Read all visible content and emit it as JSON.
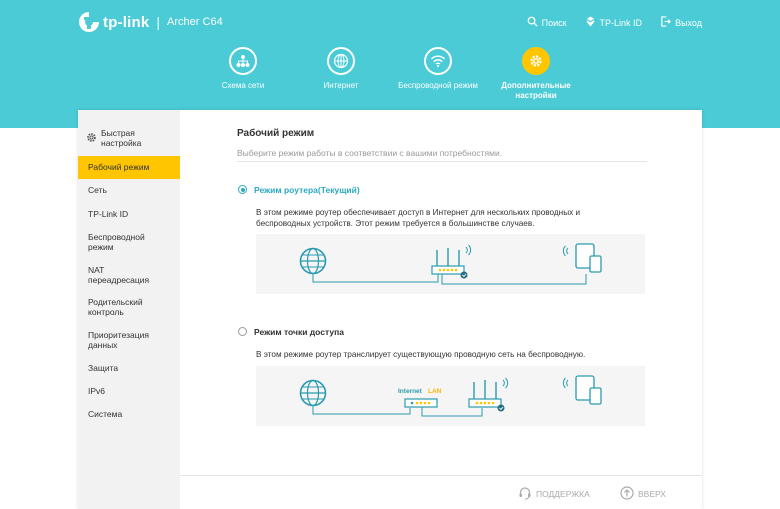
{
  "header": {
    "brand": "tp-link",
    "model": "Archer C64",
    "links": [
      {
        "label": "Поиск",
        "icon": "search-icon"
      },
      {
        "label": "TP-Link ID",
        "icon": "tplink-id-icon"
      },
      {
        "label": "Выход",
        "icon": "logout-icon"
      }
    ]
  },
  "nav": [
    {
      "label": "Схема сети",
      "icon": "network-map-icon"
    },
    {
      "label": "Интернет",
      "icon": "globe-icon"
    },
    {
      "label": "Беспроводной режим",
      "icon": "wifi-icon"
    },
    {
      "label": "Дополнительные настройки",
      "icon": "gear-icon",
      "active": true
    }
  ],
  "sidebar": {
    "items": [
      {
        "label": "Быстрая настройка",
        "icon": "gear-icon"
      },
      {
        "label": "Рабочий режим",
        "active": true
      },
      {
        "label": "Сеть"
      },
      {
        "label": "TP-Link ID"
      },
      {
        "label": "Беспроводной режим"
      },
      {
        "label": "NAT переадресация"
      },
      {
        "label": "Родительский контроль"
      },
      {
        "label": "Приоритезация данных"
      },
      {
        "label": "Защита"
      },
      {
        "label": "IPv6"
      },
      {
        "label": "Система"
      }
    ]
  },
  "main": {
    "title": "Рабочий режим",
    "subtitle": "Выберите режим работы в соответствии с вашими потребностями.",
    "options": [
      {
        "label": "Режим роутера(Текущий)",
        "selected": true,
        "description": "В этом режиме роутер обеспечивает доступ в Интернет для нескольких проводных и беспроводных устройств. Этот режим требуется в большинстве случаев."
      },
      {
        "label": "Режим точки доступа",
        "selected": false,
        "description": "В этом режиме роутер транслирует существующую проводную сеть на беспроводную.",
        "diagram_labels": {
          "internet": "Internet",
          "lan": "LAN"
        }
      }
    ]
  },
  "footer": {
    "support": "ПОДДЕРЖКА",
    "top": "ВВЕРХ"
  },
  "colors": {
    "header_bg": "#4acbd6",
    "accent": "#2aa9c1",
    "active": "#ffc600"
  }
}
